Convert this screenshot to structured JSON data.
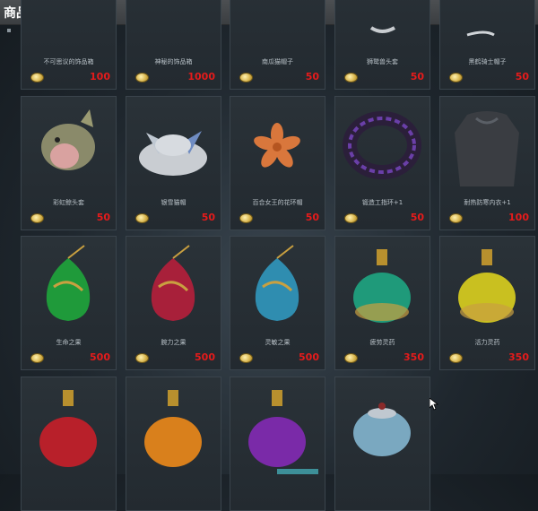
{
  "header": {
    "title": "商品列表"
  },
  "items": [
    {
      "name": "不可思议的饰品箱",
      "price": "100"
    },
    {
      "name": "神秘的饰品箱",
      "price": "1000"
    },
    {
      "name": "南瓜猫帽子",
      "price": "50"
    },
    {
      "name": "狮鹫兽头套",
      "price": "50"
    },
    {
      "name": "黑鹤骑士帽子",
      "price": "50"
    },
    {
      "name": "彩虹鲸头套",
      "price": "50"
    },
    {
      "name": "银雪猫帽",
      "price": "50"
    },
    {
      "name": "百合女王的花环帽",
      "price": "50"
    },
    {
      "name": "锻造工指环+1",
      "price": "50"
    },
    {
      "name": "耐热防寒内衣+1",
      "price": "100"
    },
    {
      "name": "生命之果",
      "price": "500"
    },
    {
      "name": "腕力之果",
      "price": "500"
    },
    {
      "name": "灵敏之果",
      "price": "500"
    },
    {
      "name": "疲劳灵药",
      "price": "350"
    },
    {
      "name": "活力灵药",
      "price": "350"
    },
    {
      "name": "",
      "price": ""
    },
    {
      "name": "",
      "price": ""
    },
    {
      "name": "",
      "price": ""
    },
    {
      "name": "",
      "price": ""
    }
  ],
  "colors": {
    "price": "#e51b1b",
    "coin": "#d6b24a",
    "title_bar": "#45484b"
  }
}
